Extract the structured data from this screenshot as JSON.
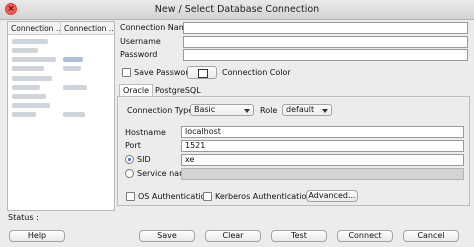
{
  "window": {
    "title": "New / Select Database Connection"
  },
  "connections": {
    "columns": [
      "Connection ...",
      "Connection ..."
    ]
  },
  "form": {
    "connection_name_label": "Connection Name",
    "username_label": "Username",
    "password_label": "Password",
    "save_password_label": "Save Password",
    "connection_color_label": "Connection Color"
  },
  "tabs": [
    "Oracle",
    "PostgreSQL"
  ],
  "oracle": {
    "connection_type_label": "Connection Type",
    "connection_type_value": "Basic",
    "role_label": "Role",
    "role_value": "default",
    "hostname_label": "Hostname",
    "hostname_value": "localhost",
    "port_label": "Port",
    "port_value": "1521",
    "sid_label": "SID",
    "sid_value": "xe",
    "service_name_label": "Service name",
    "os_auth_label": "OS Authentication",
    "kerberos_label": "Kerberos Authentication",
    "advanced_label": "Advanced..."
  },
  "status": {
    "label": "Status :"
  },
  "buttons": {
    "help": "Help",
    "save": "Save",
    "clear": "Clear",
    "test": "Test",
    "connect": "Connect",
    "cancel": "Cancel"
  }
}
